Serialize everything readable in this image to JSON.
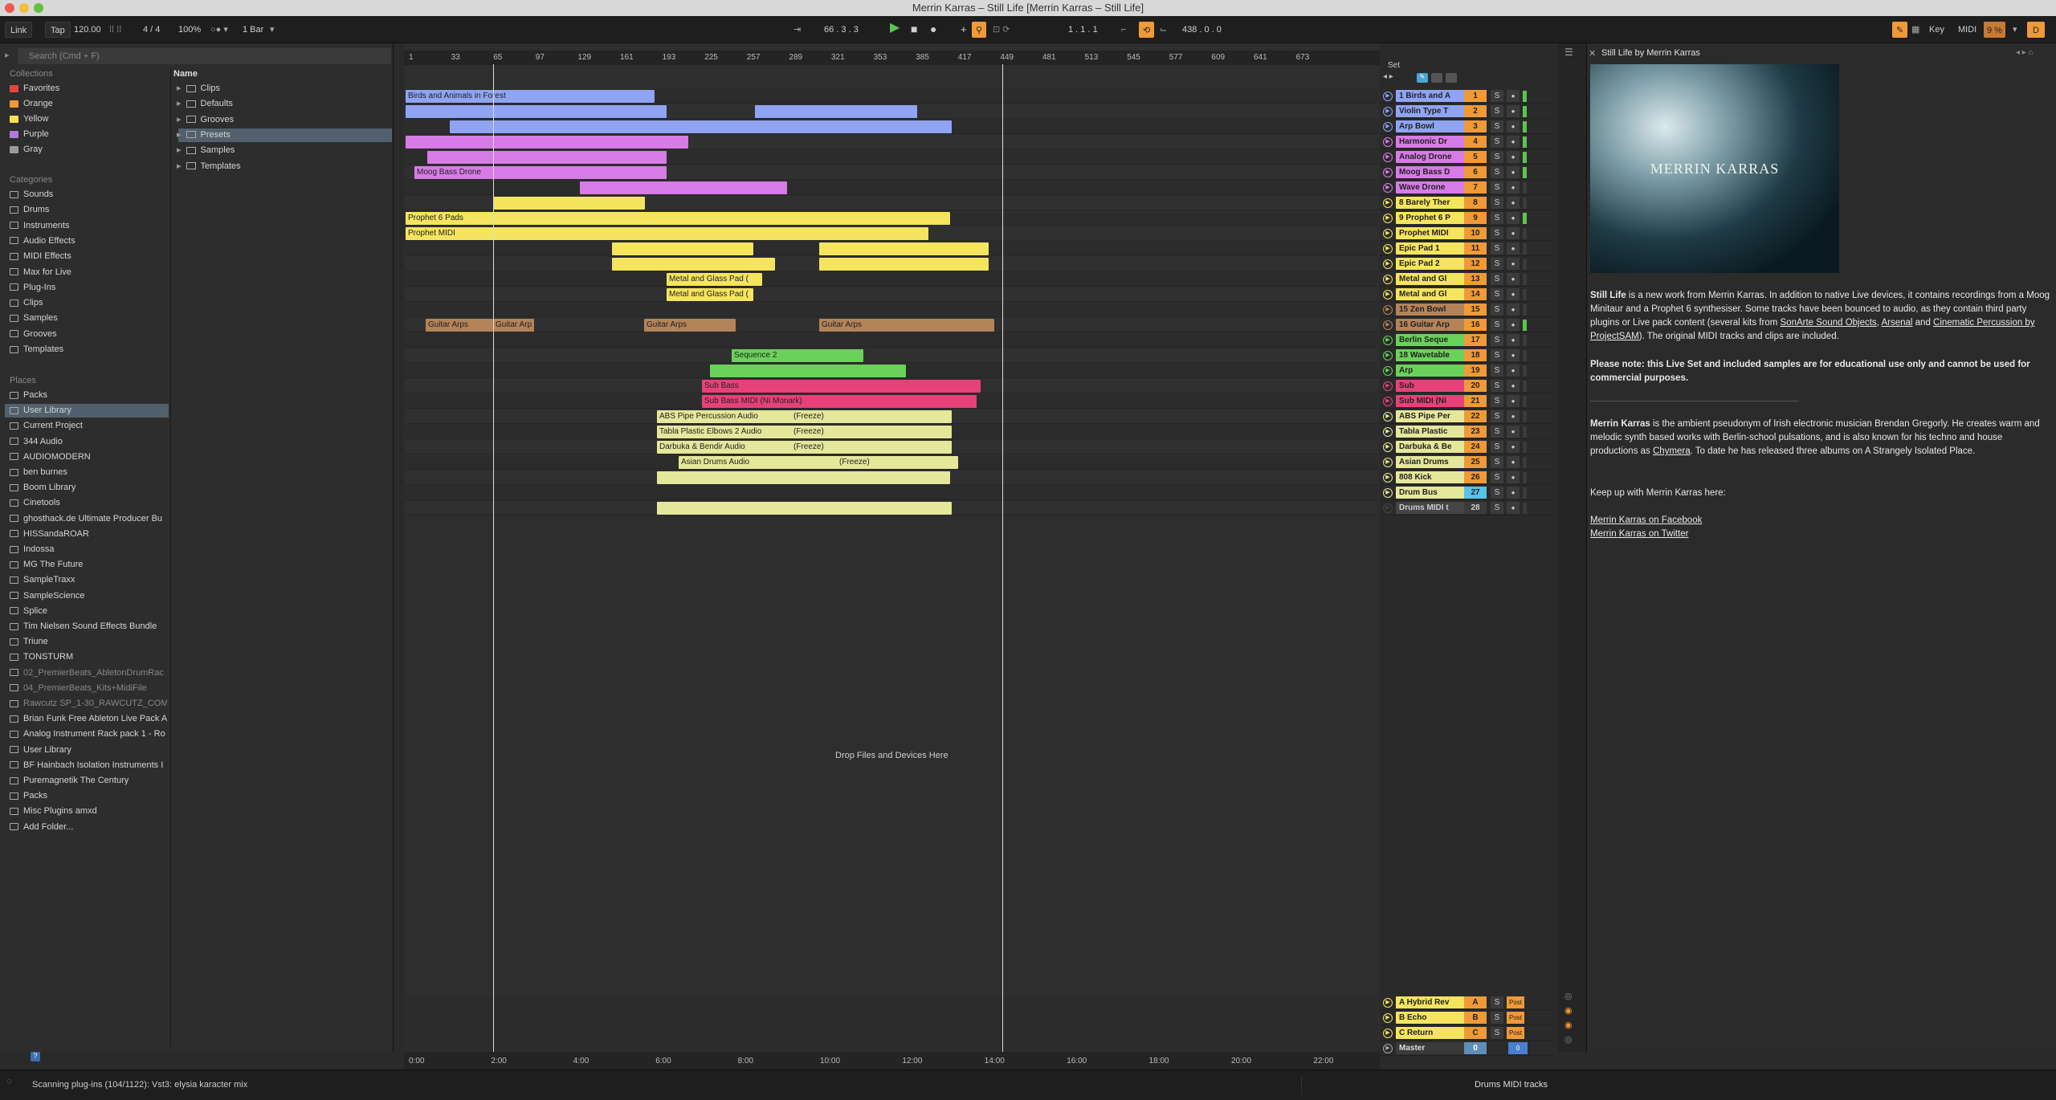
{
  "window": {
    "title": "Merrin Karras – Still Life  [Merrin Karras – Still Life]"
  },
  "control_bar": {
    "link": "Link",
    "tap": "Tap",
    "tempo": "120.00",
    "signature": "4 / 4",
    "zoom": "100%",
    "quantize": "1 Bar",
    "position": "66 .  3 .  3",
    "loop_start": "1 .  1 .  1",
    "loop_length": "438 .  0 .  0",
    "key": "Key",
    "midi": "MIDI",
    "cpu": "9 %",
    "disk": "D"
  },
  "browser": {
    "search_placeholder": "Search (Cmd + F)",
    "collections_header": "Collections",
    "collections": [
      {
        "label": "Favorites",
        "color": "#e8433c"
      },
      {
        "label": "Orange",
        "color": "#f09a37"
      },
      {
        "label": "Yellow",
        "color": "#f2e055"
      },
      {
        "label": "Purple",
        "color": "#b07ad8"
      },
      {
        "label": "Gray",
        "color": "#9a9a9a"
      }
    ],
    "categories_header": "Categories",
    "categories": [
      "Sounds",
      "Drums",
      "Instruments",
      "Audio Effects",
      "MIDI Effects",
      "Max for Live",
      "Plug-Ins",
      "Clips",
      "Samples",
      "Grooves",
      "Templates"
    ],
    "places_header": "Places",
    "places": [
      "Packs",
      "User Library",
      "Current Project",
      "344 Audio",
      "AUDIOMODERN",
      "ben burnes",
      "Boom Library",
      "Cinetools",
      "ghosthack.de Ultimate Producer Bu",
      "HISSandaROAR",
      "Indossa",
      "MG The Future",
      "SampleTraxx",
      "SampleScience",
      "Splice",
      "Tim Nielsen Sound Effects Bundle",
      "Triune",
      "TONSTURM",
      "02_PremierBeats_AbletonDrumRac",
      "04_PremierBeats_Kits+MidiFile",
      "Rawcutz SP_1-30_RAWCUTZ_COM",
      "Brian Funk Free Ableton Live Pack A",
      "Analog Instrument Rack pack 1 - Ro",
      "User Library",
      "BF Hainbach Isolation Instruments I",
      "Puremagnetik The Century",
      "Packs",
      "Misc Plugins amxd",
      "Add Folder..."
    ],
    "name_header": "Name",
    "files": [
      "Clips",
      "Defaults",
      "Grooves",
      "Presets",
      "Samples",
      "Templates"
    ]
  },
  "arrangement": {
    "ruler_ticks": [
      "1",
      "33",
      "65",
      "97",
      "129",
      "161",
      "193",
      "225",
      "257",
      "289",
      "321",
      "353",
      "385",
      "417",
      "449",
      "481",
      "513",
      "545",
      "577",
      "609",
      "641",
      "673"
    ],
    "time_ticks": [
      "0:00",
      "2:00",
      "4:00",
      "6:00",
      "8:00",
      "10:00",
      "12:00",
      "14:00",
      "16:00",
      "18:00",
      "20:00",
      "22:00"
    ],
    "set_label": "Set",
    "drop_text": "Drop Files and Devices Here",
    "clip_labels": {
      "birds": "Birds and Animals in Forest",
      "moog": "Moog Bass Drone",
      "prophet_pads": "Prophet 6 Pads",
      "prophet_midi": "Prophet MIDI",
      "metal1": "Metal and Glass Pad (",
      "metal2": "Metal and Glass Pad (",
      "guitar_a": "Guitar Arps",
      "guitar_b": "Guitar Arp",
      "guitar_c": "Guitar Arps",
      "guitar_d": "Guitar Arps",
      "seq2": "Sequence 2",
      "sub_bass": "Sub Bass",
      "sub_midi": "Sub Bass MIDI (Ni Monark)",
      "abs": "ABS Pipe Percussion Audio",
      "tabla": "Tabla Plastic Elbows 2 Audio",
      "darbuka": "Darbuka & Bendir Audio",
      "asian": "Asian Drums Audio",
      "freeze": "(Freeze)"
    }
  },
  "tracks": [
    {
      "name": "1 Birds and A",
      "num": "1",
      "color": "#8fa4f2"
    },
    {
      "name": "Violin Type T",
      "num": "2",
      "color": "#8fa4f2"
    },
    {
      "name": "Arp Bowl",
      "num": "3",
      "color": "#8fa4f2"
    },
    {
      "name": "Harmonic Dr",
      "num": "4",
      "color": "#d77be6"
    },
    {
      "name": "Analog Drone",
      "num": "5",
      "color": "#d77be6"
    },
    {
      "name": "Moog Bass D",
      "num": "6",
      "color": "#d77be6"
    },
    {
      "name": "Wave Drone",
      "num": "7",
      "color": "#d77be6"
    },
    {
      "name": "8 Barely Ther",
      "num": "8",
      "color": "#f5e45e"
    },
    {
      "name": "9 Prophet 6 P",
      "num": "9",
      "color": "#f5e45e"
    },
    {
      "name": "Prophet MIDI",
      "num": "10",
      "color": "#f5e45e"
    },
    {
      "name": "Epic Pad 1",
      "num": "11",
      "color": "#f5e45e"
    },
    {
      "name": "Epic Pad 2",
      "num": "12",
      "color": "#f5e45e"
    },
    {
      "name": "Metal and Gl",
      "num": "13",
      "color": "#f5e45e"
    },
    {
      "name": "Metal and Gl",
      "num": "14",
      "color": "#f5e45e"
    },
    {
      "name": "15 Zen Bowl",
      "num": "15",
      "color": "#b3835a"
    },
    {
      "name": "16 Guitar Arp",
      "num": "16",
      "color": "#b3835a"
    },
    {
      "name": "Berlin Seque",
      "num": "17",
      "color": "#6ad15a"
    },
    {
      "name": "18 Wavetable",
      "num": "18",
      "color": "#6ad15a"
    },
    {
      "name": "Arp",
      "num": "19",
      "color": "#6ad15a"
    },
    {
      "name": "Sub",
      "num": "20",
      "color": "#e8417a"
    },
    {
      "name": "Sub MIDI (Ni",
      "num": "21",
      "color": "#e8417a"
    },
    {
      "name": "ABS Pipe Per",
      "num": "22",
      "color": "#e5e79a"
    },
    {
      "name": "Tabla Plastic",
      "num": "23",
      "color": "#e5e79a"
    },
    {
      "name": "Darbuka & Be",
      "num": "24",
      "color": "#e5e79a"
    },
    {
      "name": "Asian Drums",
      "num": "25",
      "color": "#e5e79a"
    },
    {
      "name": "808 Kick",
      "num": "26",
      "color": "#e5e79a"
    },
    {
      "name": "Drum Bus",
      "num": "27",
      "color": "#e5e79a"
    },
    {
      "name": "Drums MIDI t",
      "num": "28",
      "color": "#454545"
    }
  ],
  "returns": [
    {
      "name": "A Hybrid Rev",
      "num": "A",
      "post": "Post"
    },
    {
      "name": "B Echo",
      "num": "B",
      "post": "Post"
    },
    {
      "name": "C Return",
      "num": "C",
      "post": "Post"
    }
  ],
  "master": {
    "name": "Master",
    "vol": "0",
    "pan": "0"
  },
  "info": {
    "title": "Still Life by Merrin Karras",
    "art_text": "MERRIN KARRAS",
    "p1_bold": "Still Life",
    "p1": " is a new work from Merrin Karras. In addition to native Live devices, it contains recordings from a Moog Minitaur and a Prophet 6 synthesiser. Some tracks have been bounced to audio, as they contain third party plugins or Live pack content (several kits from ",
    "link1": "SonArte Sound Objects",
    "link2": "Arsenal",
    "and": " and ",
    "link3": "Cinematic Percussion by ProjectSAM",
    "p1_end": "). The original MIDI tracks and clips are included.",
    "p2": "Please note: this Live Set and included samples are for educational use only and cannot be used for commercial purposes.",
    "p3_bold": "Merrin Karras",
    "p3": " is the ambient pseudonym of Irish electronic musician Brendan Gregorly. He creates warm and melodic synth based works with Berlin-school pulsations, and is also known for his techno and house productions as ",
    "link4": "Chymera",
    "p3_end": ". To date he has released three albums on A Strangely Isolated Place.",
    "p4": "Keep up with Merrin Karras here:",
    "link5": "Merrin Karras on Facebook",
    "link6": "Merrin Karras on Twitter"
  },
  "status": {
    "message": "Scanning plug-ins (104/1122): Vst3: elysia karacter mix",
    "selected_track": "Drums MIDI tracks"
  }
}
